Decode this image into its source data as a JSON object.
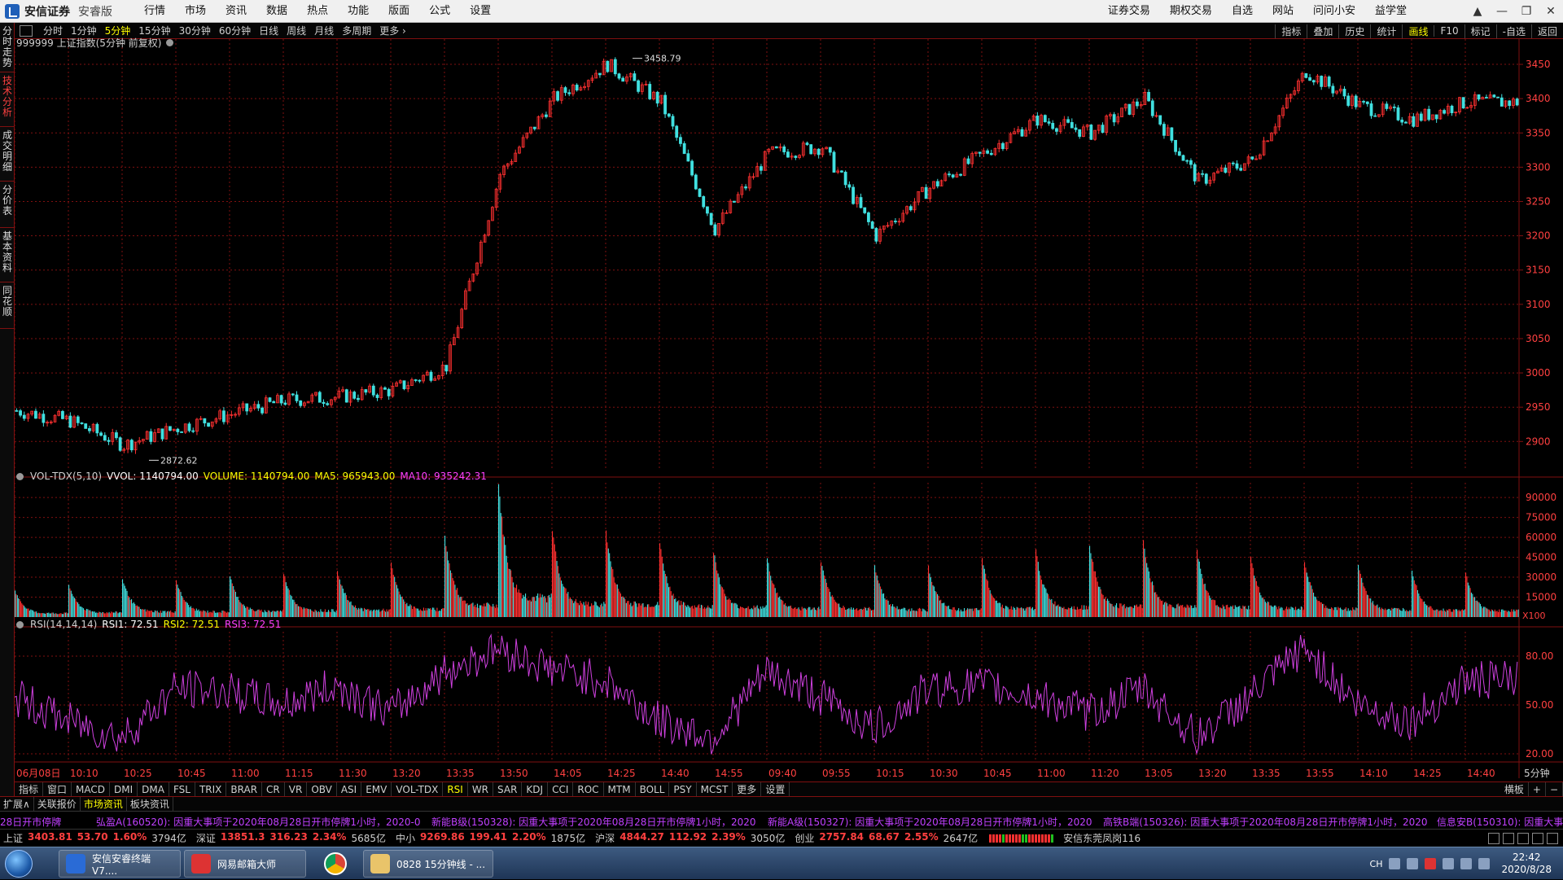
{
  "app": {
    "brand": "安信证券",
    "edition": "安睿版",
    "menu_left": [
      "行情",
      "市场",
      "资讯",
      "数据",
      "热点",
      "功能",
      "版面",
      "公式",
      "设置"
    ],
    "menu_right": [
      "证券交易",
      "期权交易",
      "自选",
      "网站",
      "问问小安",
      "益学堂"
    ],
    "window_controls": [
      "shirt-icon",
      "minimize-icon",
      "restore-icon",
      "close-icon"
    ]
  },
  "left_tabs": [
    {
      "label": "分时走势",
      "active": false
    },
    {
      "label": "技术分析",
      "active": true
    },
    {
      "label": "成交明细",
      "active": false
    },
    {
      "label": "分价表",
      "active": false
    },
    {
      "label": "基本资料",
      "active": false
    },
    {
      "label": "同花顺",
      "active": false
    }
  ],
  "period_bar": {
    "items": [
      "分时",
      "1分钟",
      "5分钟",
      "15分钟",
      "30分钟",
      "60分钟",
      "日线",
      "周线",
      "月线",
      "多周期",
      "更多 ›"
    ],
    "active": "5分钟",
    "right_items": [
      "指标",
      "叠加",
      "历史",
      "统计",
      "画线",
      "F10",
      "标记",
      "-自选",
      "返回"
    ],
    "right_active": "画线"
  },
  "main_chart": {
    "header": "999999 上证指数(5分钟 前复权)",
    "high_label": "3458.79",
    "low_label": "2872.62",
    "y_ticks": [
      "3450",
      "3400",
      "3350",
      "3300",
      "3250",
      "3200",
      "3150",
      "3100",
      "3050",
      "3000",
      "2950",
      "2900"
    ]
  },
  "volume_panel": {
    "name": "VOL-TDX(5,10)",
    "vvol": "VVOL: 1140794.00",
    "volume": "VOLUME: 1140794.00",
    "ma5": "MA5: 965943.00",
    "ma10": "MA10: 935242.31",
    "y_ticks": [
      "90000",
      "75000",
      "60000",
      "45000",
      "30000",
      "15000"
    ],
    "unit": "X100"
  },
  "rsi_panel": {
    "name": "RSI(14,14,14)",
    "rsi1": "RSI1: 72.51",
    "rsi2": "RSI2: 72.51",
    "rsi3": "RSI3: 72.51",
    "y_ticks": [
      "80.00",
      "50.00",
      "20.00"
    ]
  },
  "time_axis": {
    "labels": [
      "06月08日",
      "10:10",
      "10:25",
      "10:45",
      "11:00",
      "11:15",
      "11:30",
      "13:20",
      "13:35",
      "13:50",
      "14:05",
      "14:25",
      "14:40",
      "14:55",
      "09:40",
      "09:55",
      "10:15",
      "10:30",
      "10:45",
      "11:00",
      "11:20",
      "13:05",
      "13:20",
      "13:35",
      "13:55",
      "14:10",
      "14:25",
      "14:40"
    ],
    "period": "5分钟"
  },
  "indicator_tabs": {
    "items": [
      "指标",
      "窗口",
      "MACD",
      "DMI",
      "DMA",
      "FSL",
      "TRIX",
      "BRAR",
      "CR",
      "VR",
      "OBV",
      "ASI",
      "EMV",
      "VOL-TDX",
      "RSI",
      "WR",
      "SAR",
      "KDJ",
      "CCI",
      "ROC",
      "MTM",
      "BOLL",
      "PSY",
      "MCST",
      "更多",
      "设置"
    ],
    "active": "RSI",
    "right": [
      "横板",
      "+",
      "−"
    ]
  },
  "expand_row": {
    "items": [
      "扩展∧",
      "关联报价",
      "市场资讯",
      "板块资讯"
    ],
    "active": "市场资讯"
  },
  "ticker": [
    "28日开市停牌",
    "弘盈A(160520): 因重大事项于2020年08月28日开市停牌1小时，2020-0",
    "新能B级(150328): 因重大事项于2020年08月28日开市停牌1小时，2020",
    "新能A级(150327): 因重大事项于2020年08月28日开市停牌1小时，2020",
    "高铁B端(150326): 因重大事项于2020年08月28日开市停牌1小时，2020",
    "信息安B(150310): 因重大事项"
  ],
  "status_indices": [
    {
      "name": "上证",
      "value": "3403.81",
      "chg": "53.70",
      "pct": "1.60%",
      "amt": "3794亿"
    },
    {
      "name": "深证",
      "value": "13851.3",
      "chg": "316.23",
      "pct": "2.34%",
      "amt": "5685亿"
    },
    {
      "name": "中小",
      "value": "9269.86",
      "chg": "199.41",
      "pct": "2.20%",
      "amt": "1875亿"
    },
    {
      "name": "沪深",
      "value": "4844.27",
      "chg": "112.92",
      "pct": "2.39%",
      "amt": "3050亿"
    },
    {
      "name": "创业",
      "value": "2757.84",
      "chg": "68.67",
      "pct": "2.55%",
      "amt": "2647亿"
    }
  ],
  "station": "安信东莞凤岗116",
  "taskbar": {
    "tasks": [
      "安信安睿终端V7....",
      "网易邮箱大师",
      "",
      "0828 15分钟线 - ..."
    ],
    "tray_lang": "CH",
    "time": "22:42",
    "date": "2020/8/28"
  },
  "colors": {
    "up": "#ff3030",
    "down": "#40e0e0",
    "rsi": "#d040e0",
    "ma5": "#ffff00",
    "ma10": "#ff40ff",
    "grid": "#801010"
  },
  "chart_data": [
    {
      "type": "candlestick",
      "title": "999999 上证指数(5分钟 前复权)",
      "ylim": [
        2860,
        3475
      ],
      "x": [
        "06月08日",
        "10:10",
        "10:25",
        "10:45",
        "11:00",
        "11:15",
        "11:30",
        "13:20",
        "13:35",
        "13:50",
        "14:05",
        "14:25",
        "14:40",
        "14:55",
        "09:40",
        "09:55",
        "10:15",
        "10:30",
        "10:45",
        "11:00",
        "11:20",
        "13:05",
        "13:20",
        "13:35",
        "13:55",
        "14:10",
        "14:25",
        "14:40"
      ],
      "close": [
        2945,
        2930,
        2895,
        2920,
        2940,
        2960,
        2965,
        2975,
        3010,
        3290,
        3400,
        3450,
        3395,
        3210,
        3320,
        3330,
        3200,
        3270,
        3320,
        3370,
        3350,
        3400,
        3280,
        3310,
        3440,
        3390,
        3370,
        3395
      ],
      "high_marker": 3458.79,
      "low_marker": 2872.62
    },
    {
      "type": "bar",
      "title": "VOL-TDX(5,10)",
      "ylim": [
        0,
        95000
      ],
      "unit": "X100",
      "peaks": [
        18000,
        22000,
        26000,
        25000,
        28000,
        30000,
        32000,
        36000,
        55000,
        90000,
        60000,
        58000,
        50000,
        45000,
        40000,
        38000,
        35000,
        34000,
        40000,
        45000,
        50000,
        52000,
        45000,
        40000,
        38000,
        36000,
        32000,
        30000
      ]
    },
    {
      "type": "line",
      "title": "RSI(14,14,14)",
      "ylim": [
        15,
        95
      ],
      "series": [
        {
          "name": "RSI1",
          "values": [
            55,
            40,
            30,
            60,
            58,
            50,
            62,
            45,
            70,
            85,
            72,
            65,
            40,
            30,
            70,
            55,
            35,
            60,
            62,
            55,
            45,
            60,
            30,
            55,
            85,
            50,
            40,
            65
          ]
        }
      ]
    }
  ]
}
